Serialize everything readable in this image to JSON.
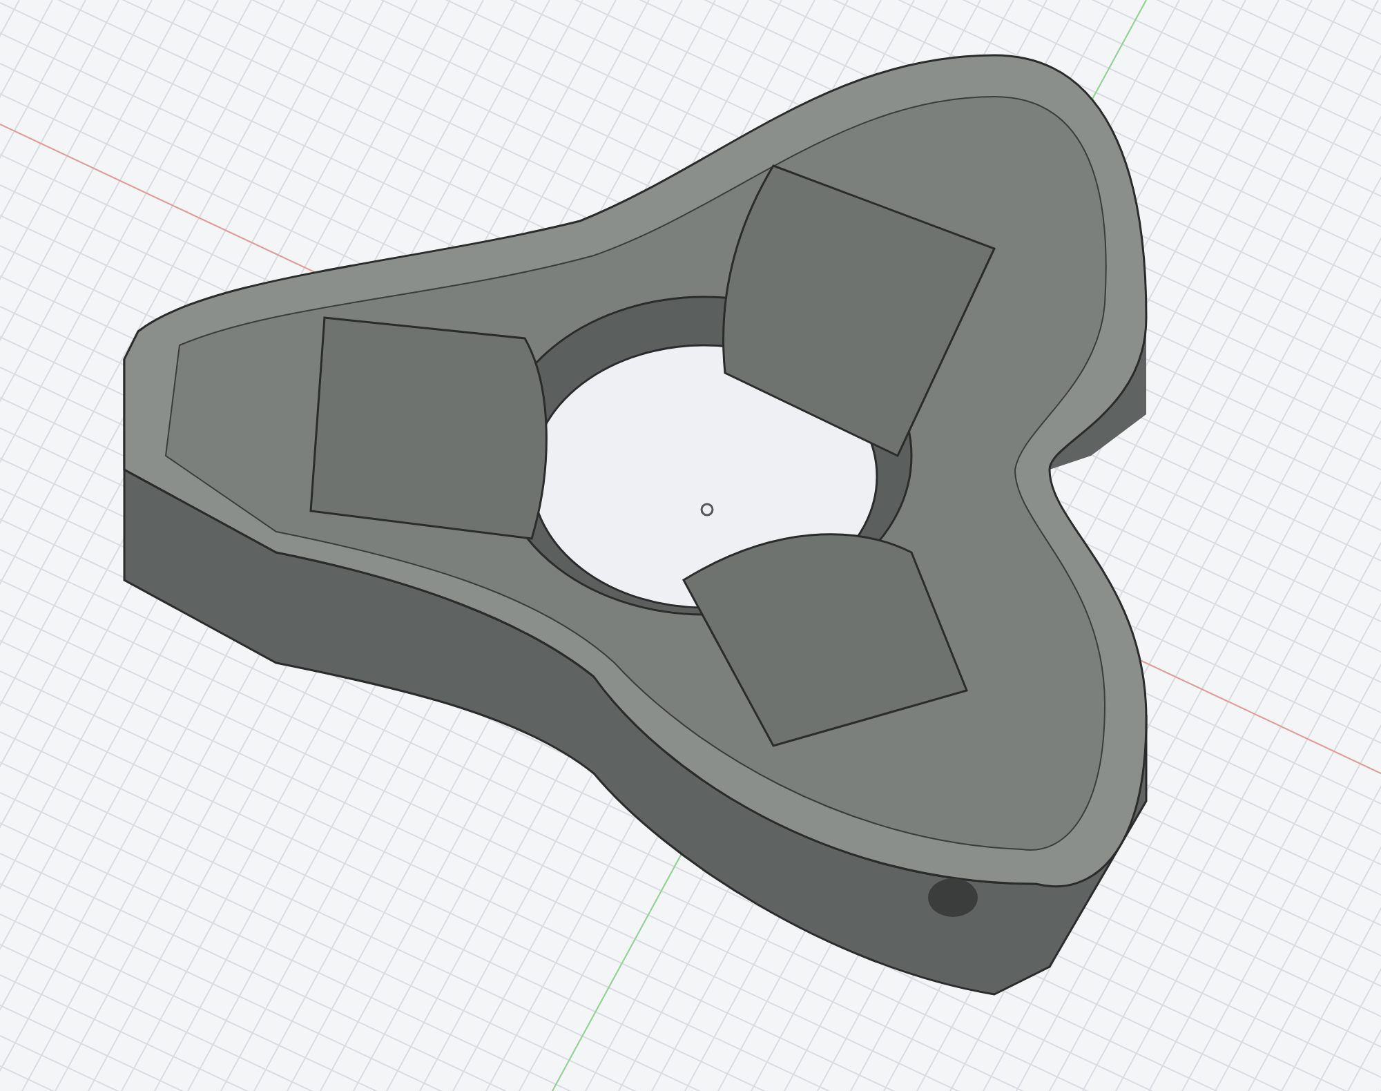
{
  "viewport": {
    "kind": "model",
    "grid": true
  }
}
